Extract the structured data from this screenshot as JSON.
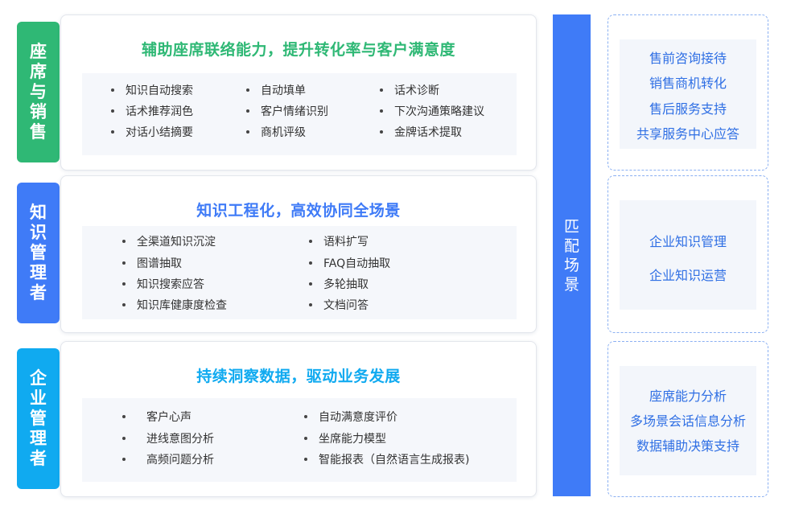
{
  "colors": {
    "green": "#2fb875",
    "blue": "#3f7bf7",
    "cyan": "#10aaf0",
    "match_bar": "#3f7bf7",
    "scene_text": "#2f6fe4",
    "scene_border": "#8bb0f2"
  },
  "rows": [
    {
      "role": "座席与销售",
      "title": "辅助座席联络能力，提升转化率与客户满意度",
      "features": [
        "知识自动搜索",
        "自动填单",
        "话术诊断",
        "话术推荐润色",
        "客户情绪识别",
        "下次沟通策略建议",
        "对话小结摘要",
        "商机评级",
        "金牌话术提取"
      ]
    },
    {
      "role": "知识管理者",
      "title": "知识工程化，高效协同全场景",
      "features": [
        "全渠道知识沉淀",
        "语料扩写",
        "图谱抽取",
        "FAQ自动抽取",
        "知识搜索应答",
        "多轮抽取",
        "知识库健康度检查",
        "文档问答"
      ]
    },
    {
      "role": "企业管理者",
      "title": "持续洞察数据，驱动业务发展",
      "features": [
        "客户心声",
        "自动满意度评价",
        "进线意图分析",
        "坐席能力模型",
        "高频问题分析",
        "智能报表（自然语言生成报表)"
      ]
    }
  ],
  "match_label": "匹配场景",
  "scenes": [
    {
      "items": [
        "售前咨询接待",
        "销售商机转化",
        "售后服务支持",
        "共享服务中心应答"
      ]
    },
    {
      "items": [
        "企业知识管理",
        "企业知识运营"
      ]
    },
    {
      "items": [
        "座席能力分析",
        "多场景会话信息分析",
        "数据辅助决策支持"
      ]
    }
  ]
}
